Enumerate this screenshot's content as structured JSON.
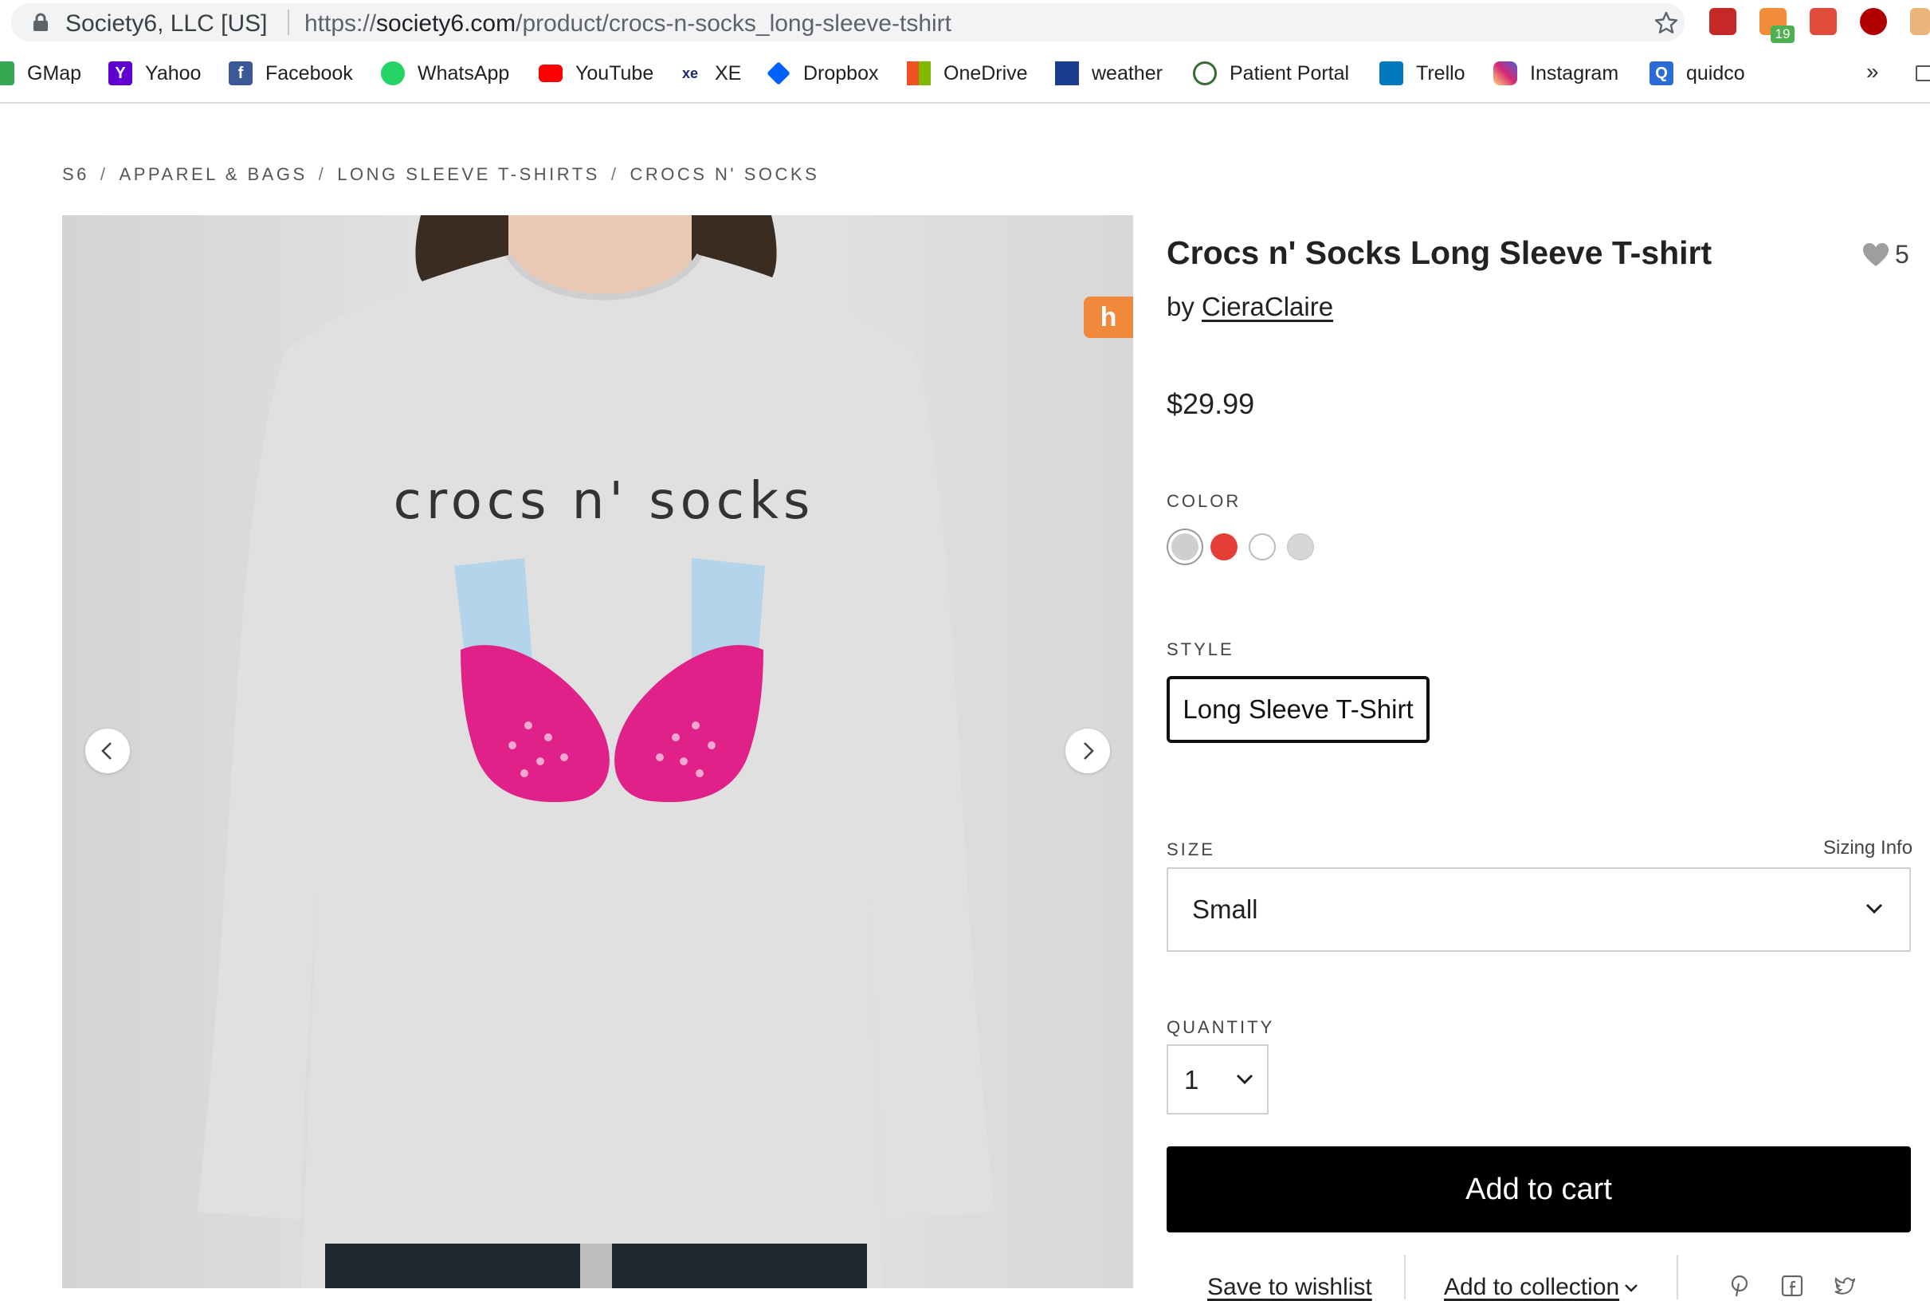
{
  "browser": {
    "site_owner": "Society6, LLC [US]",
    "url_scheme": "https://",
    "url_host": "society6.com",
    "url_path": "/product/crocs-n-socks_long-sleeve-tshirt",
    "extension_badge": "19"
  },
  "bookmarks": [
    {
      "label": "GMap",
      "icon": "gmap-icon",
      "color": "#34a853",
      "glyph": ""
    },
    {
      "label": "Yahoo",
      "icon": "yahoo-icon",
      "color": "#5f01d1",
      "glyph": "Y"
    },
    {
      "label": "Facebook",
      "icon": "facebook-icon",
      "color": "#3b5998",
      "glyph": "f"
    },
    {
      "label": "WhatsApp",
      "icon": "whatsapp-icon",
      "color": "#25d366",
      "glyph": ""
    },
    {
      "label": "YouTube",
      "icon": "youtube-icon",
      "color": "#ff0000",
      "glyph": ""
    },
    {
      "label": "XE",
      "icon": "xe-icon",
      "color": "#1a2b6d",
      "glyph": "xe"
    },
    {
      "label": "Dropbox",
      "icon": "dropbox-icon",
      "color": "#0061ff",
      "glyph": ""
    },
    {
      "label": "OneDrive",
      "icon": "onedrive-icon",
      "color": "#f25022",
      "glyph": ""
    },
    {
      "label": "weather",
      "icon": "weather-icon",
      "color": "#1b3c8f",
      "glyph": ""
    },
    {
      "label": "Patient Portal",
      "icon": "patient-portal-icon",
      "color": "#3a6b35",
      "glyph": ""
    },
    {
      "label": "Trello",
      "icon": "trello-icon",
      "color": "#0079bf",
      "glyph": ""
    },
    {
      "label": "Instagram",
      "icon": "instagram-icon",
      "color": "#c13584",
      "glyph": ""
    },
    {
      "label": "quidco",
      "icon": "quidco-icon",
      "color": "#2b6cd4",
      "glyph": "Q"
    }
  ],
  "bookmarks_more": "»",
  "breadcrumb": [
    "S6",
    "APPAREL & BAGS",
    "LONG SLEEVE T-SHIRTS",
    "CROCS N' SOCKS"
  ],
  "product": {
    "image_text": "crocs n' socks",
    "title": "Crocs n' Socks Long Sleeve T-shirt",
    "by_prefix": "by",
    "artist": "CieraClaire",
    "favorites": "5",
    "price": "$29.99",
    "color_label": "COLOR",
    "colors": [
      {
        "name": "heather-gray",
        "hex": "#cfcfcf",
        "selected": true
      },
      {
        "name": "red",
        "hex": "#e53e36",
        "selected": false
      },
      {
        "name": "white",
        "hex": "#ffffff",
        "selected": false
      },
      {
        "name": "light-gray",
        "hex": "#d6d6d6",
        "selected": false
      }
    ],
    "style_label": "STYLE",
    "style_value": "Long Sleeve T-Shirt",
    "size_label": "SIZE",
    "sizing_info": "Sizing Info",
    "size_value": "Small",
    "quantity_label": "QUANTITY",
    "quantity_value": "1",
    "add_to_cart": "Add to cart",
    "save_to_wishlist": "Save to wishlist",
    "add_to_collection": "Add to collection"
  },
  "honey_badge": "h",
  "colors": {
    "cart_button": "#000000",
    "croc_pink": "#e0218a",
    "sock_blue": "#b3d4ea",
    "honey_orange": "#f0893c"
  }
}
